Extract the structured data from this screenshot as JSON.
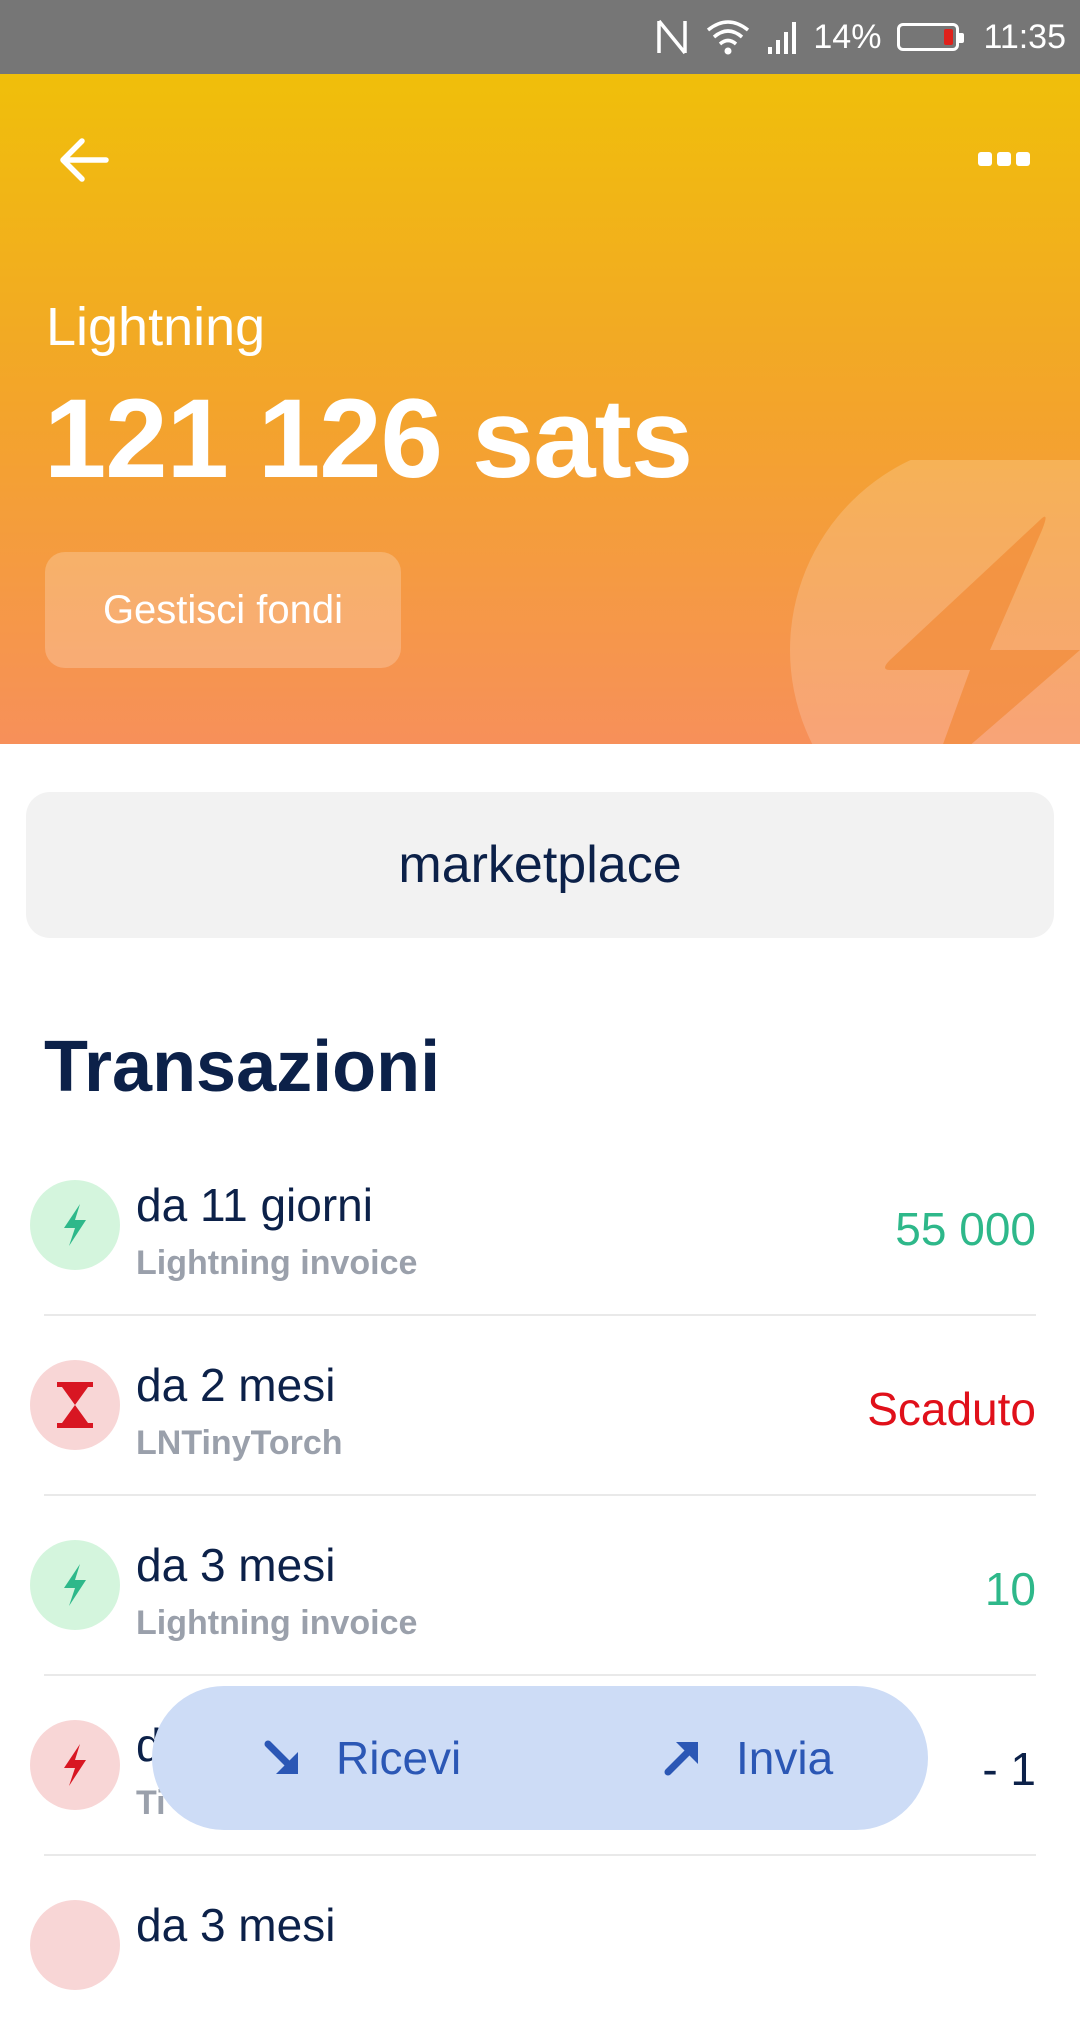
{
  "status_bar": {
    "icons": [
      "nfc-icon",
      "wifi-icon",
      "signal-icon"
    ],
    "battery_percent": "14%",
    "battery_level": 0.14,
    "time": "11:35"
  },
  "header": {
    "account_label": "Lightning",
    "balance": "121 126 sats",
    "manage_button": "Gestisci fondi",
    "colors": {
      "top": "#f0bf0a",
      "bottom": "#f7905a"
    }
  },
  "marketplace": {
    "label": "marketplace"
  },
  "transactions": {
    "title": "Transazioni",
    "items": [
      {
        "time": "da 11 giorni",
        "description": "Lightning invoice",
        "amount": "55 000",
        "kind": "incoming",
        "icon": "lightning-icon"
      },
      {
        "time": "da 2 mesi",
        "description": "LNTinyTorch",
        "amount": "Scaduto",
        "kind": "expired",
        "icon": "hourglass-icon"
      },
      {
        "time": "da 3 mesi",
        "description": "Lightning invoice",
        "amount": "10",
        "kind": "incoming",
        "icon": "lightning-icon"
      },
      {
        "time": "d",
        "description": "Ti",
        "amount": "- 1",
        "kind": "outgoing",
        "icon": "lightning-icon"
      },
      {
        "time": "da 3 mesi",
        "description": "",
        "amount": "",
        "kind": "outgoing",
        "icon": "lightning-icon"
      }
    ]
  },
  "actions": {
    "receive": "Ricevi",
    "send": "Invia"
  },
  "colors": {
    "text_primary": "#0c2149",
    "positive": "#2eb88a",
    "expired": "#e0101a",
    "pill_bg": "#cddcf6",
    "pill_text": "#2b57b5"
  }
}
